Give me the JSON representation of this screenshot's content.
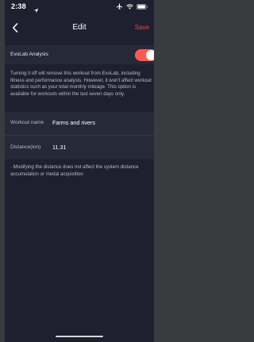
{
  "status_bar": {
    "time": "2:38",
    "icons": [
      "location-arrow-icon",
      "airplane-icon",
      "wifi-icon",
      "battery-icon"
    ]
  },
  "nav": {
    "back_icon": "chevron-left-icon",
    "title": "Edit",
    "save_label": "Save"
  },
  "evolab": {
    "label": "EvoLab Analysis",
    "enabled": true,
    "description": "Turning it off will remove this workout from EvoLab, including fitness and performance analysis. However, it won't affect workout statistics such as your total monthly mileage. This option is available for workouts within the last seven days only."
  },
  "form": {
    "workout_name_label": "Workout name",
    "workout_name_value": "Farms and rivers",
    "distance_label": "Distance(km)",
    "distance_value": "11.31"
  },
  "note": "· Modifying the distance does not affect the system distance accumulation or medal acquisition",
  "colors": {
    "background": "#1e2030",
    "row_background": "#262938",
    "accent": "#e8463d",
    "toggle_on": "#ff5a52"
  }
}
